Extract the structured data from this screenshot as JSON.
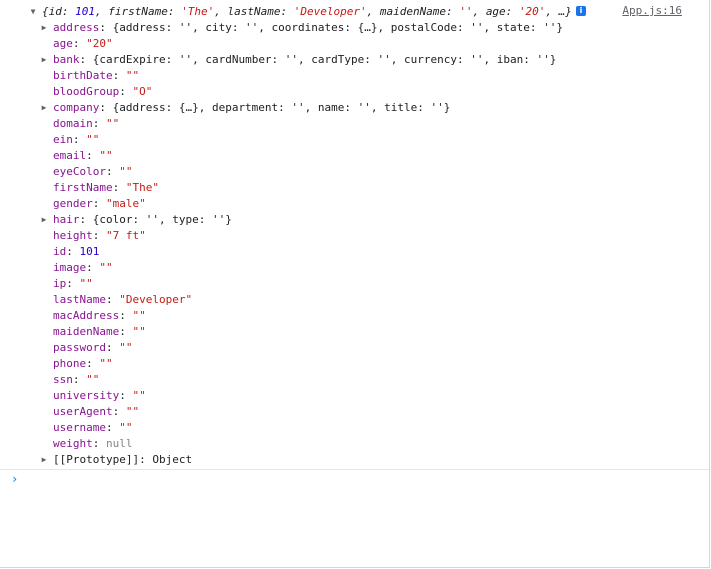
{
  "source_link": "App.js:16",
  "info_badge": "i",
  "prompt_symbol": "›",
  "summary": {
    "open": "{",
    "segments": [
      {
        "k": "id",
        "v": "101",
        "t": "num"
      },
      {
        "k": "firstName",
        "v": "'The'",
        "t": "str"
      },
      {
        "k": "lastName",
        "v": "'Developer'",
        "t": "str"
      },
      {
        "k": "maidenName",
        "v": "''",
        "t": "str"
      },
      {
        "k": "age",
        "v": "'20'",
        "t": "str"
      }
    ],
    "close": ", …}"
  },
  "properties": [
    {
      "key": "address",
      "expandable": true,
      "preview": "{address: '', city: '', coordinates: {…}, postalCode: '', state: ''}"
    },
    {
      "key": "age",
      "value": "\"20\"",
      "type": "str"
    },
    {
      "key": "bank",
      "expandable": true,
      "preview": "{cardExpire: '', cardNumber: '', cardType: '', currency: '', iban: ''}"
    },
    {
      "key": "birthDate",
      "value": "\"\"",
      "type": "str"
    },
    {
      "key": "bloodGroup",
      "value": "\"O\"",
      "type": "str"
    },
    {
      "key": "company",
      "expandable": true,
      "preview": "{address: {…}, department: '', name: '', title: ''}"
    },
    {
      "key": "domain",
      "value": "\"\"",
      "type": "str"
    },
    {
      "key": "ein",
      "value": "\"\"",
      "type": "str"
    },
    {
      "key": "email",
      "value": "\"\"",
      "type": "str"
    },
    {
      "key": "eyeColor",
      "value": "\"\"",
      "type": "str"
    },
    {
      "key": "firstName",
      "value": "\"The\"",
      "type": "str"
    },
    {
      "key": "gender",
      "value": "\"male\"",
      "type": "str"
    },
    {
      "key": "hair",
      "expandable": true,
      "preview": "{color: '', type: ''}"
    },
    {
      "key": "height",
      "value": "\"7 ft\"",
      "type": "str"
    },
    {
      "key": "id",
      "value": "101",
      "type": "num"
    },
    {
      "key": "image",
      "value": "\"\"",
      "type": "str"
    },
    {
      "key": "ip",
      "value": "\"\"",
      "type": "str"
    },
    {
      "key": "lastName",
      "value": "\"Developer\"",
      "type": "str"
    },
    {
      "key": "macAddress",
      "value": "\"\"",
      "type": "str"
    },
    {
      "key": "maidenName",
      "value": "\"\"",
      "type": "str"
    },
    {
      "key": "password",
      "value": "\"\"",
      "type": "str"
    },
    {
      "key": "phone",
      "value": "\"\"",
      "type": "str"
    },
    {
      "key": "ssn",
      "value": "\"\"",
      "type": "str"
    },
    {
      "key": "university",
      "value": "\"\"",
      "type": "str"
    },
    {
      "key": "userAgent",
      "value": "\"\"",
      "type": "str"
    },
    {
      "key": "username",
      "value": "\"\"",
      "type": "str"
    },
    {
      "key": "weight",
      "value": "null",
      "type": "null"
    }
  ],
  "prototype": {
    "key": "[[Prototype]]",
    "value": "Object"
  }
}
